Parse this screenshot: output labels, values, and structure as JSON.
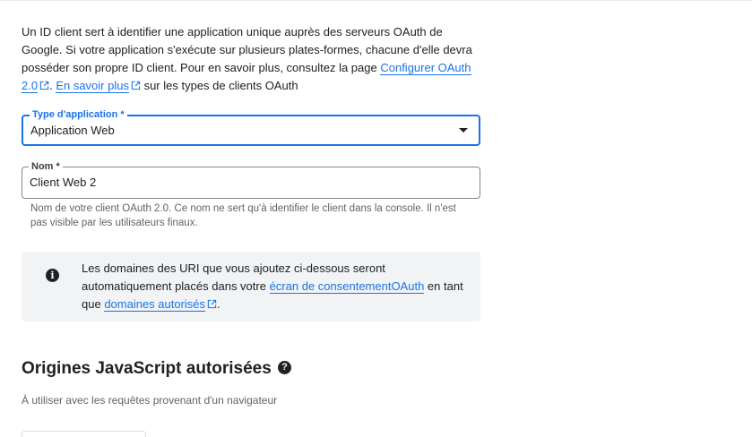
{
  "intro": {
    "text_before_link1": "Un ID client sert à identifier une application unique auprès des serveurs OAuth de Google. Si votre application s'exécute sur plusieurs plates-formes, chacune d'elle devra posséder son propre ID client. Pour en savoir plus, consultez la page ",
    "link1": "Configurer OAuth 2.0",
    "separator": ". ",
    "link2": "En savoir plus",
    "text_after": " sur les types de clients OAuth"
  },
  "app_type": {
    "label": "Type d'application *",
    "value": "Application Web"
  },
  "name_field": {
    "label": "Nom *",
    "value": "Client Web 2",
    "helper": "Nom de votre client OAuth 2.0. Ce nom ne sert qu'à identifier le client dans la console. Il n'est pas visible par les utilisateurs finaux."
  },
  "notice": {
    "text1": "Les domaines des URI que vous ajoutez ci-dessous seront automatiquement placés dans votre ",
    "link1": "écran de consentementOAuth",
    "text2": " en tant que ",
    "link2": "domaines autorisés",
    "text3": "."
  },
  "js_origins": {
    "title": "Origines JavaScript autorisées",
    "subtitle": "À utiliser avec les requêtes provenant d'un navigateur"
  },
  "icons": {
    "info": "info-icon",
    "help": "help-icon",
    "external": "external-link-icon",
    "dropdown": "dropdown-arrow-icon"
  },
  "colors": {
    "accent": "#1a73e8",
    "text": "#202124",
    "secondary_text": "#5f6368",
    "notice_bg": "#f1f3f4"
  }
}
